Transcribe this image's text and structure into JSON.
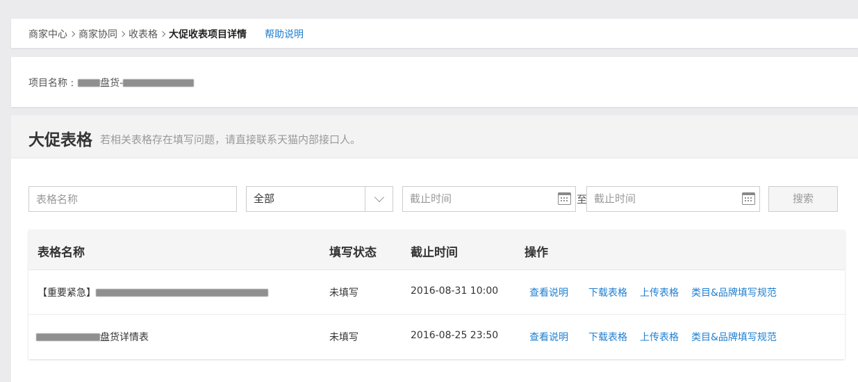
{
  "breadcrumb": {
    "items": [
      "商家中心",
      "商家协同",
      "收表格"
    ],
    "current": "大促收表项目详情",
    "help": "帮助说明"
  },
  "project": {
    "label": "项目名称 :",
    "name_visible": "盘货-"
  },
  "section": {
    "title": "大促表格",
    "subtitle": "若相关表格存在填写问题，请直接联系天猫内部接口人。"
  },
  "filters": {
    "name_placeholder": "表格名称",
    "status_selected": "全部",
    "date_start_placeholder": "截止时间",
    "date_end_placeholder": "截止时间",
    "to_label": "至",
    "search_label": "搜索"
  },
  "table": {
    "headers": [
      "表格名称",
      "填写状态",
      "截止时间",
      "操作"
    ],
    "actions": [
      "查看说明",
      "下载表格",
      "上传表格",
      "类目&品牌填写规范"
    ],
    "rows": [
      {
        "name_prefix": "【重要紧急】",
        "name_suffix": "",
        "status": "未填写",
        "deadline": "2016-08-31 10:00"
      },
      {
        "name_prefix": "",
        "name_suffix": "盘货详情表",
        "status": "未填写",
        "deadline": "2016-08-25 23:50"
      }
    ]
  },
  "colors": {
    "link": "#1e7fd0",
    "background": "#ebebed"
  }
}
